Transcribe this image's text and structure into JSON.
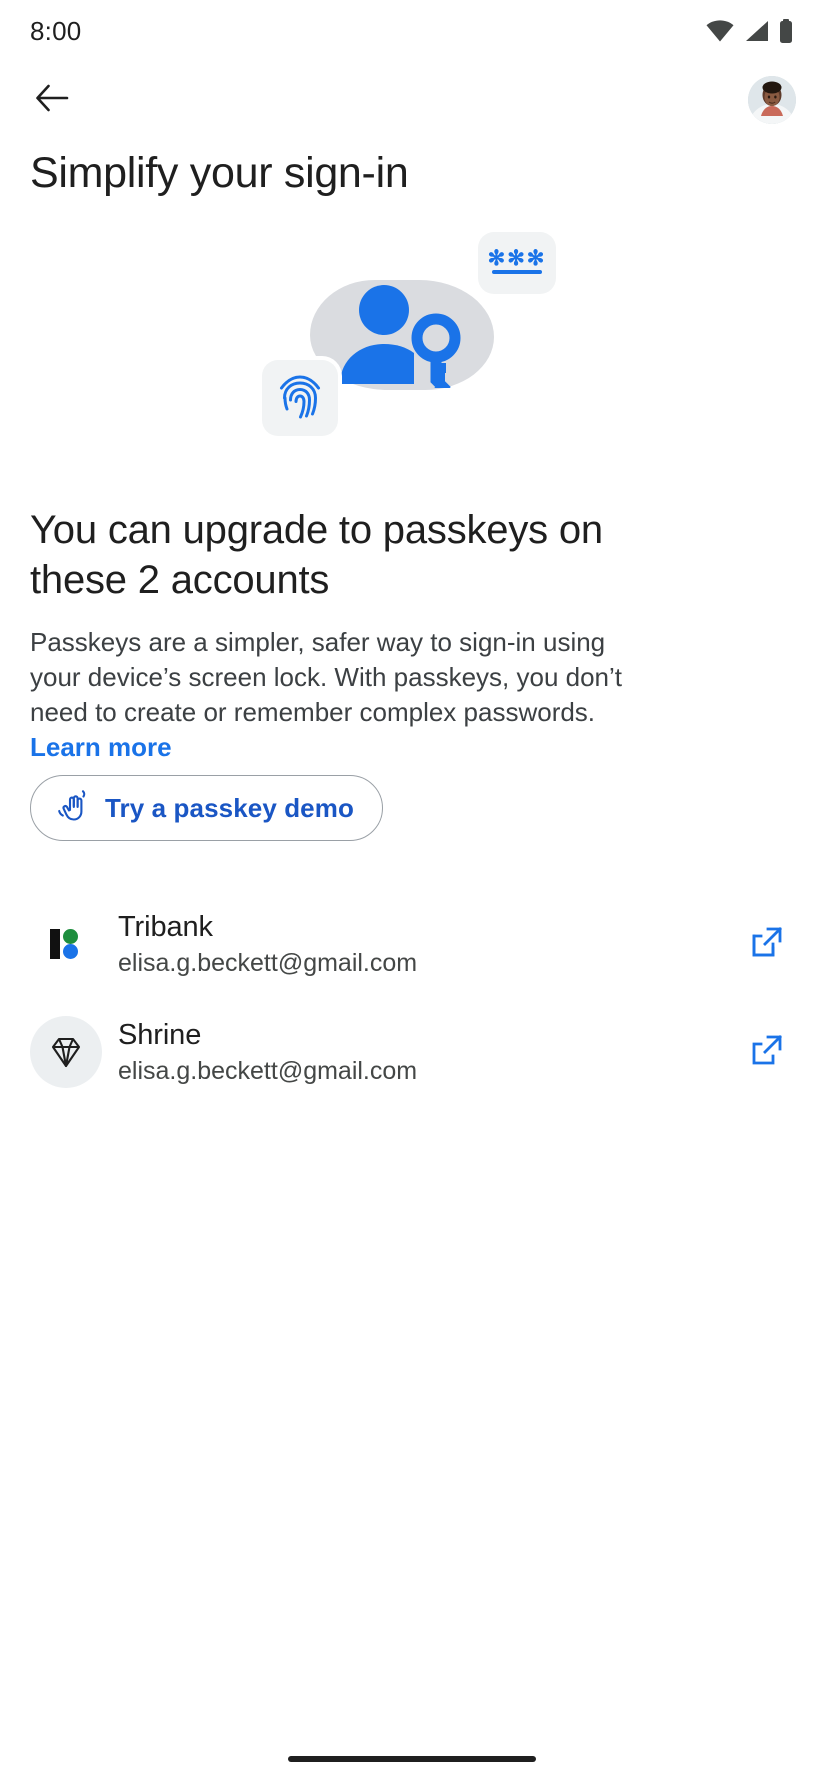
{
  "status_bar": {
    "time": "8:00",
    "icons": [
      "wifi-icon",
      "cellular-icon",
      "battery-icon"
    ]
  },
  "app_bar": {
    "back_icon": "back-arrow-icon",
    "avatar_label": "Account avatar"
  },
  "page_title": "Simplify your sign-in",
  "illustration": {
    "person_icon": "person-with-key-icon",
    "password_card_stars": "✻✻✻",
    "fingerprint_icon": "fingerprint-icon"
  },
  "headline": "You can upgrade to passkeys on these 2 accounts",
  "body": {
    "text": "Passkeys are a simpler, safer way to sign-in using your device’s screen lock. With passkeys, you don’t need to create or remember complex passwords. ",
    "learn_more": "Learn more"
  },
  "demo_button": {
    "label": "Try a passkey demo",
    "icon": "touch-hand-icon"
  },
  "accounts": [
    {
      "name": "Tribank",
      "email": "elisa.g.beckett@gmail.com",
      "logo": "tribank-logo",
      "action_icon": "open-in-new-icon"
    },
    {
      "name": "Shrine",
      "email": "elisa.g.beckett@gmail.com",
      "logo": "shrine-diamond-logo",
      "action_icon": "open-in-new-icon"
    }
  ],
  "colors": {
    "accent_blue": "#1a73e8",
    "link_blue": "#1a56c4",
    "text_primary": "#1f1f1f",
    "text_secondary": "#3c4043",
    "blob_gray": "#dadce0",
    "card_gray": "#f1f3f4",
    "tribank_green": "#1e8e3e",
    "tribank_blue": "#1a73e8"
  }
}
